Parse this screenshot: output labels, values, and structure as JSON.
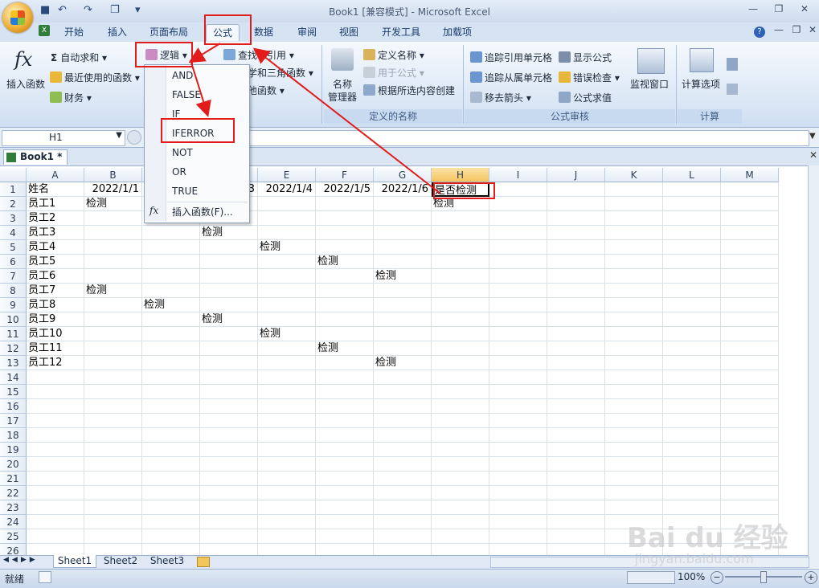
{
  "window": {
    "title": "Book1  [兼容模式] - Microsoft Excel"
  },
  "qat": [
    "■",
    "↶",
    "↷",
    "❐",
    "▾"
  ],
  "tabs": [
    "开始",
    "插入",
    "页面布局",
    "公式",
    "数据",
    "审阅",
    "视图",
    "开发工具",
    "加载项"
  ],
  "ribbon": {
    "insert_function": "插入函数",
    "fx_symbol": "fx",
    "autosum": "自动求和",
    "recent": "最近使用的函数",
    "finance": "财务",
    "logic": "逻辑",
    "lookup": "查找与引用",
    "math": "数学和三角函数",
    "other": "其他函数",
    "name_mgr_1": "名称",
    "name_mgr_2": "管理器",
    "define_name": "定义名称",
    "use_in_formula": "用于公式",
    "create_from_sel": "根据所选内容创建",
    "trace_precedents": "追踪引用单元格",
    "trace_dependents": "追踪从属单元格",
    "remove_arrows": "移去箭头",
    "show_formulas": "显示公式",
    "error_check": "错误检查",
    "eval_formula": "公式求值",
    "watch_window": "监视窗口",
    "calc_options": "计算选项",
    "group_defined_names": "定义的名称",
    "group_auditing": "公式审核",
    "group_calc": "计算"
  },
  "name_box": "H1",
  "workbook_tab": "Book1 *",
  "logic_menu": {
    "items": [
      "AND",
      "FALSE",
      "IF",
      "IFERROR",
      "NOT",
      "OR",
      "TRUE"
    ],
    "insert_fn": "插入函数(F)...",
    "fx": "fx"
  },
  "columns": [
    "A",
    "B",
    "C",
    "D",
    "E",
    "F",
    "G",
    "H",
    "I",
    "J",
    "K",
    "L",
    "M"
  ],
  "rows": [
    "1",
    "2",
    "3",
    "4",
    "5",
    "6",
    "7",
    "8",
    "9",
    "10",
    "11",
    "12",
    "13",
    "14",
    "15",
    "16",
    "17",
    "18",
    "19",
    "20",
    "21",
    "22",
    "23",
    "24",
    "25",
    "26"
  ],
  "cells": {
    "A1": "姓名",
    "B1": "2022/1/1",
    "D1": "2022/1/3",
    "E1": "2022/1/4",
    "F1": "2022/1/5",
    "G1": "2022/1/6",
    "H1": "是否检测",
    "A2": "员工1",
    "B2": "检测",
    "H2": "检测",
    "A3": "员工2",
    "A4": "员工3",
    "D4": "检测",
    "A5": "员工4",
    "E5": "检测",
    "A6": "员工5",
    "F6": "检测",
    "A7": "员工6",
    "G7": "检测",
    "A8": "员工7",
    "B8": "检测",
    "A9": "员工8",
    "C9": "检测",
    "A10": "员工9",
    "D10": "检测",
    "A11": "员工10",
    "E11": "检测",
    "A12": "员工11",
    "F12": "检测",
    "A13": "员工12",
    "G13": "检测"
  },
  "sheets": [
    "Sheet1",
    "Sheet2",
    "Sheet3"
  ],
  "status": {
    "mode": "就绪",
    "zoom": "100%"
  },
  "watermark": {
    "logo": "Bai du 经验",
    "url": "jingyan.baidu.com"
  }
}
